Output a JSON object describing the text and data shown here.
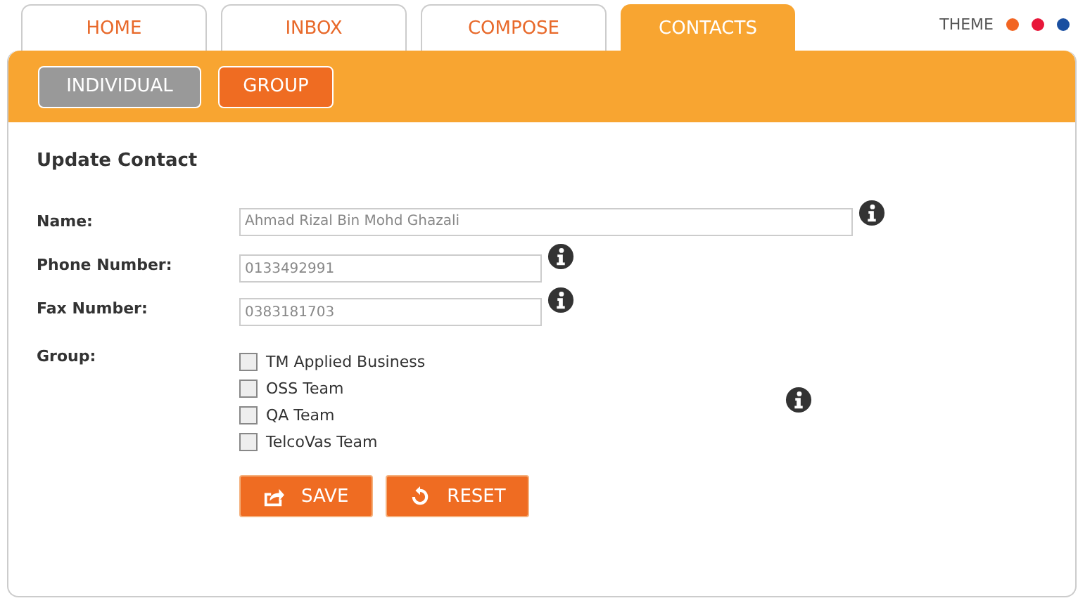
{
  "tabs": [
    {
      "label": "HOME",
      "selected": false
    },
    {
      "label": "INBOX",
      "selected": false
    },
    {
      "label": "COMPOSE",
      "selected": false
    },
    {
      "label": "CONTACTS",
      "selected": true
    }
  ],
  "theme": {
    "label": "THEME",
    "swatches": [
      {
        "color": "#f26522"
      },
      {
        "color": "#e8173a"
      },
      {
        "color": "#1a4fa0"
      }
    ]
  },
  "subtabs": [
    {
      "label": "INDIVIDUAL",
      "selected": true
    },
    {
      "label": "GROUP",
      "selected": false
    }
  ],
  "form": {
    "title": "Update Contact",
    "fields": [
      {
        "label": "Name:",
        "value": "Ahmad Rizal Bin Mohd Ghazali",
        "kind": "wide"
      },
      {
        "label": "Phone Number:",
        "value": "0133492991",
        "kind": "short"
      },
      {
        "label": "Fax Number:",
        "value": "0383181703",
        "kind": "short"
      }
    ],
    "group": {
      "label": "Group:",
      "options": [
        {
          "label": "TM Applied Business",
          "checked": false
        },
        {
          "label": "OSS Team",
          "checked": false
        },
        {
          "label": "QA Team",
          "checked": false
        },
        {
          "label": "TelcoVas Team",
          "checked": false
        }
      ]
    },
    "buttons": [
      {
        "label": "SAVE",
        "kind": "save"
      },
      {
        "label": "RESET",
        "kind": "reset"
      }
    ]
  }
}
